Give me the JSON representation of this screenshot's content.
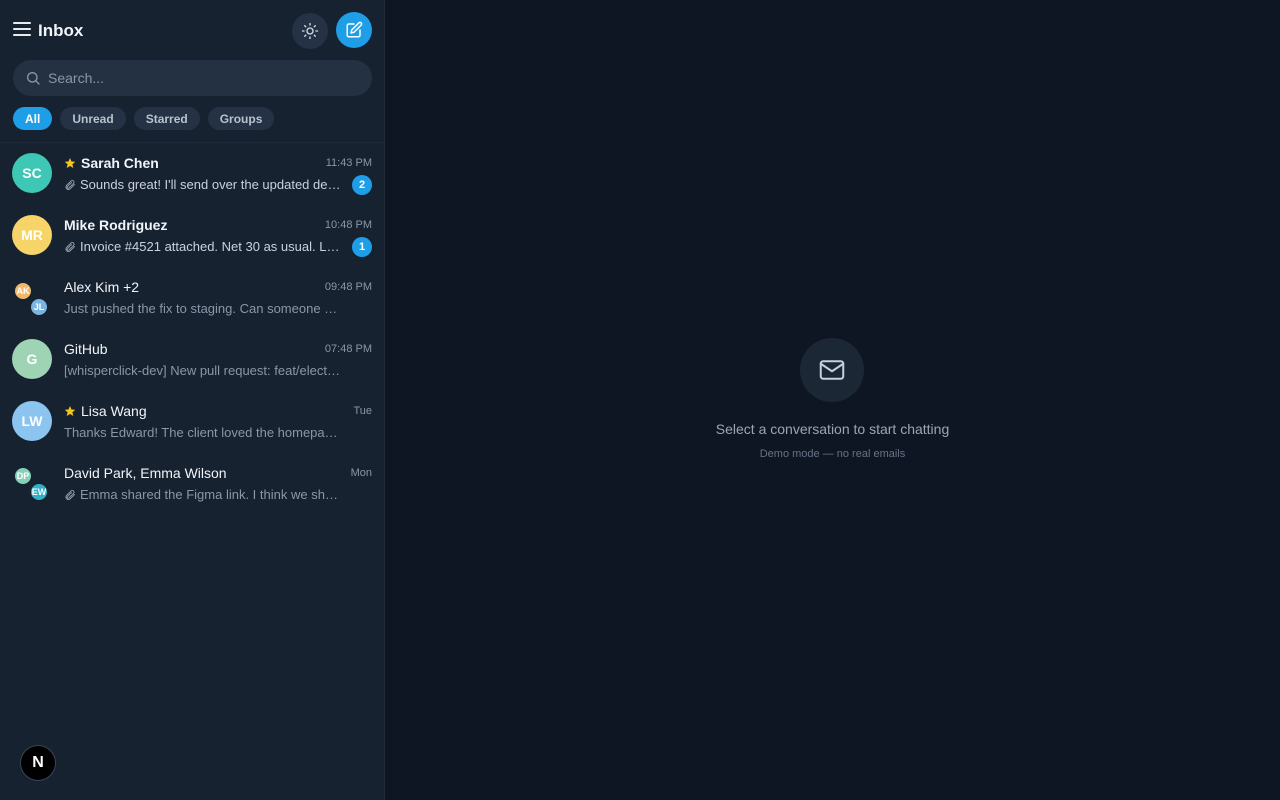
{
  "header": {
    "title": "Inbox"
  },
  "search": {
    "placeholder": "Search..."
  },
  "filters": [
    "All",
    "Unread",
    "Starred",
    "Groups"
  ],
  "conversations": [
    {
      "initials": "SC",
      "name": "Sarah Chen",
      "starred": true,
      "time": "11:43 PM",
      "preview": "Sounds great! I'll send over the updated des...",
      "attachment": true,
      "unread": "2",
      "color": "#3ec7b4"
    },
    {
      "initials": "MR",
      "name": "Mike Rodriguez",
      "starred": false,
      "time": "10:48 PM",
      "preview": "Invoice #4521 attached. Net 30 as usual. Let...",
      "attachment": true,
      "unread": "1",
      "color": "#f6d468"
    },
    {
      "group": [
        "AK",
        "JL"
      ],
      "name": "Alex Kim +2",
      "time": "09:48 PM",
      "preview": "Just pushed the fix to staging. Can someone QA?",
      "attachment": false,
      "colors": [
        "#f0b86b",
        "#7ab4e0"
      ]
    },
    {
      "initials": "G",
      "name": "GitHub",
      "time": "07:48 PM",
      "preview": "[whisperclick-dev] New pull request: feat/electron-a...",
      "attachment": false,
      "color": "#9ed3b4"
    },
    {
      "initials": "LW",
      "name": "Lisa Wang",
      "starred": true,
      "time": "Tue",
      "preview": "Thanks Edward! The client loved the homepage. Th...",
      "attachment": false,
      "color": "#8bc4ee"
    },
    {
      "group": [
        "DP",
        "EW"
      ],
      "name": "David Park, Emma Wilson",
      "time": "Mon",
      "preview": "Emma shared the Figma link. I think we should g...",
      "attachment": true,
      "colors": [
        "#86d0b8",
        "#2fb2c9"
      ]
    }
  ],
  "empty_state": {
    "title": "Select a conversation to start chatting",
    "subtitle": "Demo mode — no real emails"
  },
  "dev_badge": "N",
  "colors": {
    "accent": "#1f9ee8",
    "sidebar": "#172230",
    "background": "#0f1623",
    "star": "#f5c518"
  }
}
